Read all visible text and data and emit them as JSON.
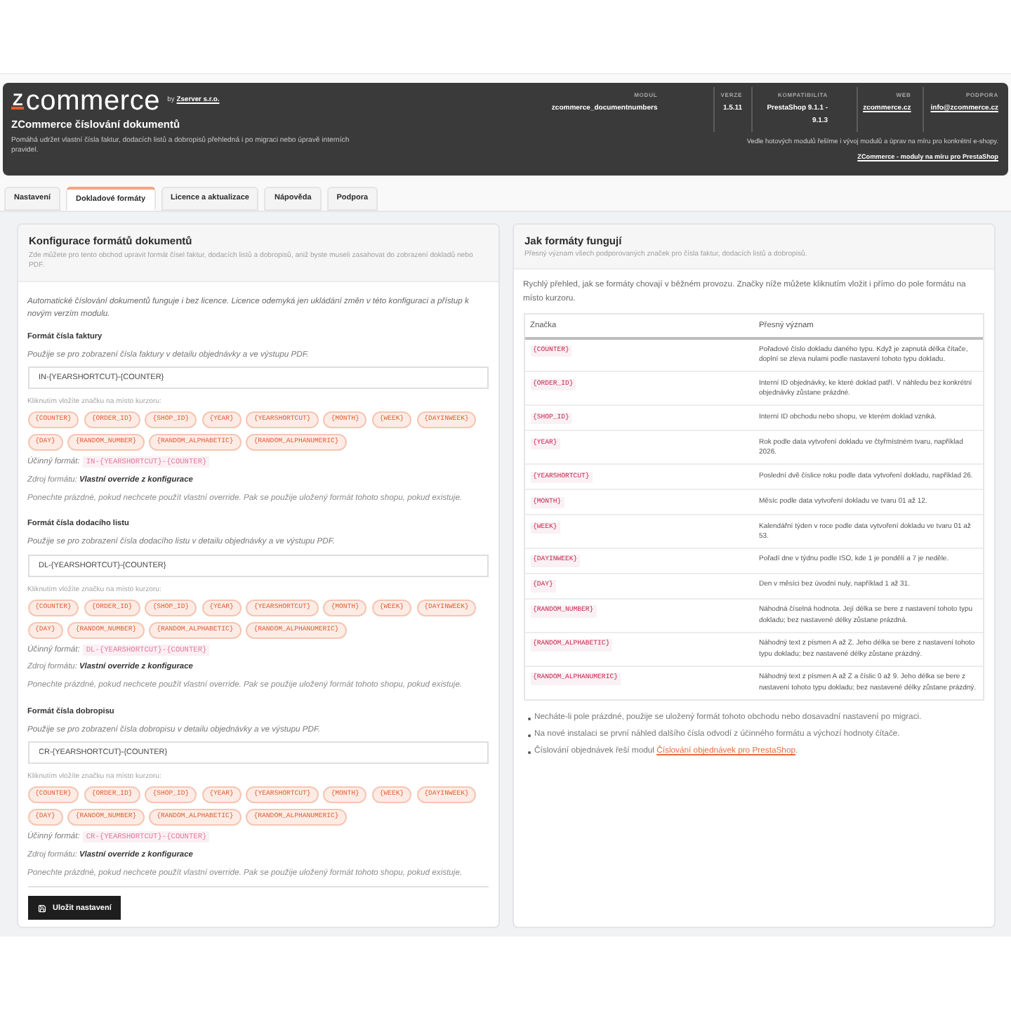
{
  "header": {
    "logo": {
      "mark": "Z",
      "wordmark": "commerce",
      "by": "by",
      "vendor": "Zserver s.r.o."
    },
    "title": "ZCommerce číslování dokumentů",
    "description": "Pomáhá udržet vlastní čísla faktur, dodacích listů a dobropisů přehledná i po migraci nebo úpravě interních pravidel.",
    "meta": [
      {
        "label": "MODUL",
        "value": "zcommerce_documentnumbers",
        "kind": "text"
      },
      {
        "label": "VERZE",
        "value": "1.5.11",
        "kind": "text"
      },
      {
        "label": "KOMPATIBILITA",
        "value": "PrestaShop 9.1.1 - 9.1.3",
        "kind": "text"
      },
      {
        "label": "WEB",
        "value": "zcommerce.cz",
        "kind": "link"
      },
      {
        "label": "PODPORA",
        "value": "info@zcommerce.cz",
        "kind": "link"
      }
    ],
    "note": "Vedle hotových modulů řešíme i vývoj modulů a úprav na míru pro konkrétní e-shopy.",
    "link": "ZCommerce - moduly na míru pro PrestaShop"
  },
  "tabs": [
    {
      "label": "Nastavení",
      "selected": false
    },
    {
      "label": "Dokladové formáty",
      "selected": true
    },
    {
      "label": "Licence a aktualizace",
      "selected": false
    },
    {
      "label": "Nápověda",
      "selected": false
    },
    {
      "label": "Podpora",
      "selected": false
    }
  ],
  "config_card": {
    "title": "Konfigurace formátů dokumentů",
    "subtitle": "Zde můžete pro tento obchod upravit formát čísel faktur, dodacích listů a dobropisů, aniž byste museli zasahovat do zobrazení dokladů nebo PDF.",
    "intro": "Automatické číslování dokumentů funguje i bez licence. Licence odemyká jen ukládání změn v této konfiguraci a přístup k novým verzím modulu.",
    "sections": [
      {
        "title": "Formát čísla faktury",
        "hint": "Použije se pro zobrazení čísla faktury v detailu objednávky a ve výstupu PDF.",
        "value": "IN-{YEARSHORTCUT}-{COUNTER}",
        "chips_label": "Kliknutím vložíte značku na místo kurzoru:",
        "chips": [
          "{COUNTER}",
          "{ORDER_ID}",
          "{SHOP_ID}",
          "{YEAR}",
          "{YEARSHORTCUT}",
          "{MONTH}",
          "{WEEK}",
          "{DAYINWEEK}",
          "{DAY}",
          "{RANDOM_NUMBER}",
          "{RANDOM_ALPHABETIC}",
          "{RANDOM_ALPHANUMERIC}"
        ],
        "effective_label": "Účinný formát:",
        "effective_value": "IN-{YEARSHORTCUT}-{COUNTER}",
        "source": "Zdroj formátu: **Vlastní override z konfigurace**",
        "note": "Ponechte prázdné, pokud nechcete použít vlastní override. Pak se použije uložený formát tohoto shopu, pokud existuje."
      },
      {
        "title": "Formát čísla dodacího listu",
        "hint": "Použije se pro zobrazení čísla dodacího listu v detailu objednávky a ve výstupu PDF.",
        "value": "DL-{YEARSHORTCUT}-{COUNTER}",
        "chips_label": "Kliknutím vložíte značku na místo kurzoru:",
        "chips": [
          "{COUNTER}",
          "{ORDER_ID}",
          "{SHOP_ID}",
          "{YEAR}",
          "{YEARSHORTCUT}",
          "{MONTH}",
          "{WEEK}",
          "{DAYINWEEK}",
          "{DAY}",
          "{RANDOM_NUMBER}",
          "{RANDOM_ALPHABETIC}",
          "{RANDOM_ALPHANUMERIC}"
        ],
        "effective_label": "Účinný formát:",
        "effective_value": "DL-{YEARSHORTCUT}-{COUNTER}",
        "source": "Zdroj formátu: **Vlastní override z konfigurace**",
        "note": "Ponechte prázdné, pokud nechcete použít vlastní override. Pak se použije uložený formát tohoto shopu, pokud existuje."
      },
      {
        "title": "Formát čísla dobropisu",
        "hint": "Použije se pro zobrazení čísla dobropisu v detailu objednávky a ve výstupu PDF.",
        "value": "CR-{YEARSHORTCUT}-{COUNTER}",
        "chips_label": "Kliknutím vložíte značku na místo kurzoru:",
        "chips": [
          "{COUNTER}",
          "{ORDER_ID}",
          "{SHOP_ID}",
          "{YEAR}",
          "{YEARSHORTCUT}",
          "{MONTH}",
          "{WEEK}",
          "{DAYINWEEK}",
          "{DAY}",
          "{RANDOM_NUMBER}",
          "{RANDOM_ALPHABETIC}",
          "{RANDOM_ALPHANUMERIC}"
        ],
        "effective_label": "Účinný formát:",
        "effective_value": "CR-{YEARSHORTCUT}-{COUNTER}",
        "source": "Zdroj formátu: **Vlastní override z konfigurace**",
        "note": "Ponechte prázdné, pokud nechcete použít vlastní override. Pak se použije uložený formát tohoto shopu, pokud existuje."
      }
    ],
    "save_button": "Uložit nastavení"
  },
  "help_card": {
    "title": "Jak formáty fungují",
    "subtitle": "Přesný význam všech podporovaných značek pro čísla faktur, dodacích listů a dobropisů.",
    "intro": "Rychlý přehled, jak se formáty chovají v běžném provozu. Značky níže můžete kliknutím vložit i přímo do pole formátu na místo kurzoru.",
    "table": {
      "columns": [
        "Značka",
        "Přesný význam"
      ],
      "rows": [
        {
          "token": "{COUNTER}",
          "meaning": "Pořadové číslo dokladu daného typu. Když je zapnutá délka čítače, doplní se zleva nulami podle nastavení tohoto typu dokladu."
        },
        {
          "token": "{ORDER_ID}",
          "meaning": "Interní ID objednávky, ke které doklad patří. V náhledu bez konkrétní objednávky zůstane prázdné."
        },
        {
          "token": "{SHOP_ID}",
          "meaning": "Interní ID obchodu nebo shopu, ve kterém doklad vzniká."
        },
        {
          "token": "{YEAR}",
          "meaning": "Rok podle data vytvoření dokladu ve čtyřmístném tvaru, například 2026."
        },
        {
          "token": "{YEARSHORTCUT}",
          "meaning": "Poslední dvě číslice roku podle data vytvoření dokladu, například 26."
        },
        {
          "token": "{MONTH}",
          "meaning": "Měsíc podle data vytvoření dokladu ve tvaru 01 až 12."
        },
        {
          "token": "{WEEK}",
          "meaning": "Kalendářní týden v roce podle data vytvoření dokladu ve tvaru 01 až 53."
        },
        {
          "token": "{DAYINWEEK}",
          "meaning": "Pořadí dne v týdnu podle ISO, kde 1 je pondělí a 7 je neděle."
        },
        {
          "token": "{DAY}",
          "meaning": "Den v měsíci bez úvodní nuly, například 1 až 31."
        },
        {
          "token": "{RANDOM_NUMBER}",
          "meaning": "Náhodná číselná hodnota. Její délka se bere z nastavení tohoto typu dokladu; bez nastavené délky zůstane prázdná."
        },
        {
          "token": "{RANDOM_ALPHABETIC}",
          "meaning": "Náhodný text z písmen A až Z. Jeho délka se bere z nastavení tohoto typu dokladu; bez nastavené délky zůstane prázdný."
        },
        {
          "token": "{RANDOM_ALPHANUMERIC}",
          "meaning": "Náhodný text z písmen A až Z a číslic 0 až 9. Jeho délka se bere z nastavení tohoto typu dokladu; bez nastavené délky zůstane prázdný."
        }
      ]
    },
    "notes": [
      {
        "text": "Necháte-li pole prázdné, použije se uložený formát tohoto obchodu nebo dosavadní nastavení po migraci."
      },
      {
        "text": "Na nové instalaci se první náhled dalšího čísla odvodí z účinného formátu a výchozí hodnoty čítače."
      },
      {
        "text": "Číslování objednávek řeší modul",
        "link": "Číslování objednávek pro PrestaShop",
        "suffix": "."
      }
    ]
  }
}
